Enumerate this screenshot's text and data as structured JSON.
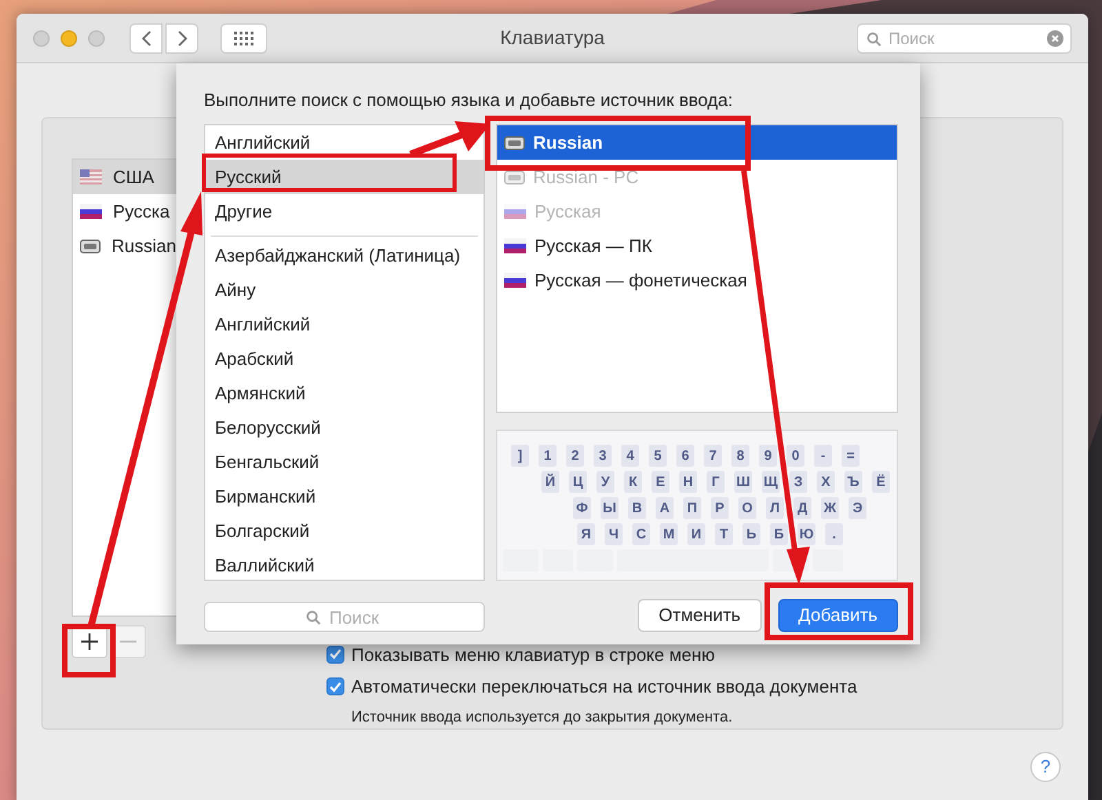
{
  "window": {
    "title": "Клавиатура",
    "search": {
      "placeholder": "Поиск"
    }
  },
  "input_sources": [
    {
      "label": "США",
      "kind": "flag-us",
      "selected": true
    },
    {
      "label": "Русска",
      "kind": "flag-ru",
      "selected": false
    },
    {
      "label": "Russian",
      "kind": "keyboard",
      "selected": false
    }
  ],
  "options": [
    {
      "label": "Показывать меню клавиатур в строке меню",
      "checked": true
    },
    {
      "label": "Автоматически переключаться на источник ввода документа",
      "checked": true
    }
  ],
  "note": "Источник ввода используется до закрытия документа.",
  "sheet": {
    "heading": "Выполните поиск с помощью языка и добавьте источник ввода:",
    "languages_top": [
      {
        "label": "Английский",
        "selected": false
      },
      {
        "label": "Русский",
        "selected": true
      },
      {
        "label": "Другие",
        "selected": false
      }
    ],
    "languages": [
      "Азербайджанский (Латиница)",
      "Айну",
      "Английский",
      "Арабский",
      "Армянский",
      "Белорусский",
      "Бенгальский",
      "Бирманский",
      "Болгарский",
      "Валлийский"
    ],
    "sources": [
      {
        "label": "Russian",
        "kind": "keyboard",
        "selected": true,
        "disabled": false
      },
      {
        "label": "Russian - PC",
        "kind": "keyboard",
        "selected": false,
        "disabled": true
      },
      {
        "label": "Русская",
        "kind": "flag",
        "selected": false,
        "disabled": true
      },
      {
        "label": "Русская — ПК",
        "kind": "flag",
        "selected": false,
        "disabled": false
      },
      {
        "label": "Русская — фонетическая",
        "kind": "flag",
        "selected": false,
        "disabled": false
      }
    ],
    "keyboard": [
      [
        "]",
        "1",
        "2",
        "3",
        "4",
        "5",
        "6",
        "7",
        "8",
        "9",
        "0",
        "-",
        "="
      ],
      [
        "Й",
        "Ц",
        "У",
        "К",
        "Е",
        "Н",
        "Г",
        "Ш",
        "Щ",
        "З",
        "Х",
        "Ъ",
        "Ё"
      ],
      [
        "Ф",
        "Ы",
        "В",
        "А",
        "П",
        "Р",
        "О",
        "Л",
        "Д",
        "Ж",
        "Э"
      ],
      [
        "Я",
        "Ч",
        "С",
        "М",
        "И",
        "Т",
        "Ь",
        "Б",
        "Ю",
        "."
      ]
    ],
    "search": {
      "placeholder": "Поиск"
    },
    "buttons": [
      {
        "label": "Отменить",
        "kind": "secondary"
      },
      {
        "label": "Добавить",
        "kind": "primary"
      }
    ]
  },
  "help": "?"
}
